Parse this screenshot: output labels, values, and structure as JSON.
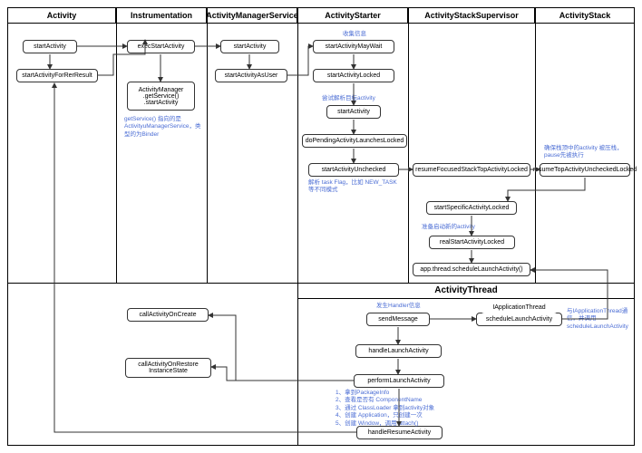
{
  "lanes": [
    "Activity",
    "Instrumentation",
    "ActivityManagerService",
    "ActivityStarter",
    "ActivityStackSupervisor",
    "ActivityStack"
  ],
  "nodes": {
    "a1": "startActivity",
    "a2": "startActivityForRerResult",
    "i1": "execStartActivity",
    "i2": "ActivityManager\n.getService()\n.startActivity",
    "m1": "startActivity",
    "m2": "startActivityAsUser",
    "s1": "startActivityMayWait",
    "s2": "startActivityLocked",
    "s3": "startActivity",
    "s4": "doPendingActivityLaunchesLocked",
    "s5": "startActivityUnchecked",
    "sv1": "resumeFocusedStackTopActivityLocked",
    "sv2": "startSpecificActivityLocked",
    "sv3": "realStartActivityLocked",
    "sv4": "app.thread.scheduleLaunchActivity()",
    "st1": "resumeTopActivityUncheckedLocked",
    "t1": "sendMessage",
    "t2": "handleLaunchActivity",
    "t3": "performLaunchActivity",
    "t4": "handleResumeActivity",
    "t5": "scheduleLaunchActivity",
    "t6": "IApplicationThread",
    "c1": "callActivityOnCreate",
    "c2": "callActivityOnRestore\nInstanceState"
  },
  "ann": {
    "n1": "getService() 指向的是ActivityuManagerService，类型的为Binder",
    "n2": "收集信息",
    "n3": "尝试解析目标activity",
    "n4": "解析 task Flag，比如 NEW_TASK等不同模式",
    "n5": "确保栈顶中的activity 被压栈，pause先被执行",
    "n6": "准备启动新的activity",
    "n7": "发生Handler信息",
    "n8": "1、拿到PackageInfo\n2、查看是否有 ComponentName\n3、通过 ClassLoader 拿到activity对象\n4、创建 Application，只创建一次\n5、创建 Window，调用 attach()",
    "n9": "与IApplicationThread通信，并调用scheduleLaunchActivity"
  },
  "section": "ActivityThread"
}
